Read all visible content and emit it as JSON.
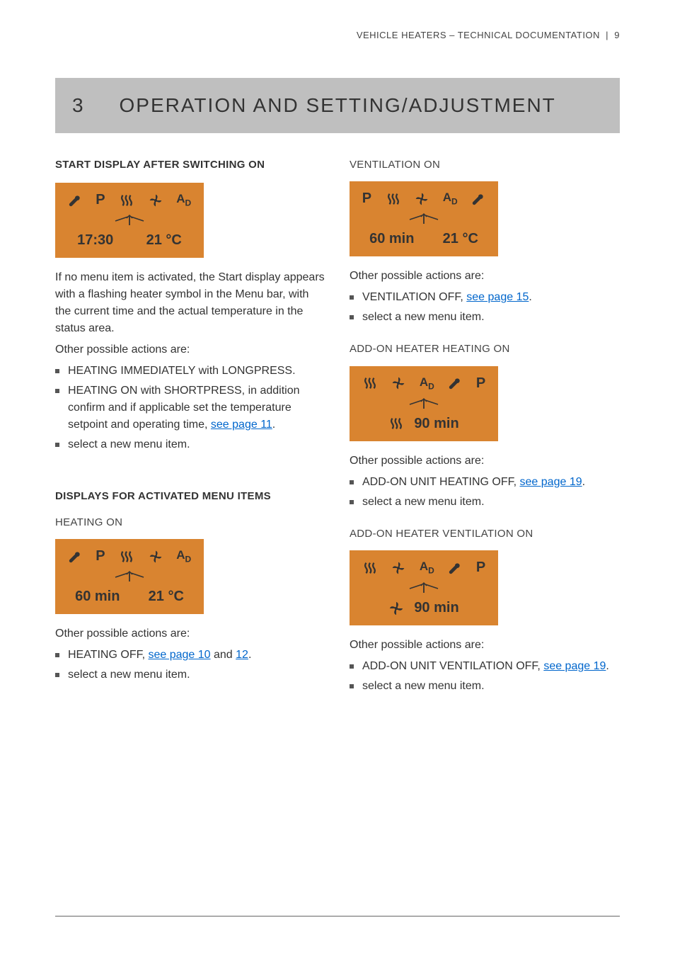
{
  "header": {
    "title": "VEHICLE HEATERS – TECHNICAL DOCUMENTATION",
    "page": "9"
  },
  "chapter": {
    "num": "3",
    "title": "OPERATION AND SETTING/ADJUSTMENT"
  },
  "left": {
    "sec1_title": "START DISPLAY AFTER SWITCHING ON",
    "sec1_display": {
      "time": "17:30",
      "temp": "21 °C",
      "icons": {
        "p": "P",
        "ad": "A",
        "ad_sub": "D"
      }
    },
    "sec1_para": "If no menu item is activated, the Start display appears with a flashing heater symbol in the Menu bar, with the current time and the actual temperature in the status area.",
    "sec1_actions_label": "Other possible actions are:",
    "sec1_li1": "HEATING IMMEDIATELY with LONGPRESS.",
    "sec1_li2a": "HEATING ON with SHORTPRESS, in addition confirm and if applicable set the temperature setpoint and operating time, ",
    "sec1_li2_link": "see page 11",
    "sec1_li2b": ".",
    "sec1_li3": "select a new menu item.",
    "sec2_title": "DISPLAYS FOR ACTIVATED MENU ITEMS",
    "sec2_sub": "HEATING ON",
    "sec2_display": {
      "time": "60 min",
      "temp": "21 °C",
      "icons": {
        "p": "P",
        "ad": "A",
        "ad_sub": "D"
      }
    },
    "sec2_actions_label": "Other possible actions are:",
    "sec2_li1a": "HEATING OFF, ",
    "sec2_li1_link1": "see page 10",
    "sec2_li1_mid": " and ",
    "sec2_li1_link2": "12",
    "sec2_li1b": ".",
    "sec2_li2": "select a new menu item."
  },
  "right": {
    "sec3_sub": "VENTILATION ON",
    "sec3_display": {
      "time": "60 min",
      "temp": "21 °C",
      "icons": {
        "p": "P",
        "ad": "A",
        "ad_sub": "D"
      }
    },
    "sec3_actions_label": "Other possible actions are:",
    "sec3_li1a": "VENTILATION OFF, ",
    "sec3_li1_link": "see page 15",
    "sec3_li1b": ".",
    "sec3_li2": "select a new menu item.",
    "sec4_sub": " ADD-ON HEATER HEATING ON",
    "sec4_display": {
      "time": "90 min",
      "icons": {
        "p": "P",
        "ad": "A",
        "ad_sub": "D"
      }
    },
    "sec4_actions_label": "Other possible actions are:",
    "sec4_li1a": "ADD-ON UNIT HEATING OFF, ",
    "sec4_li1_link": "see page 19",
    "sec4_li1b": ".",
    "sec4_li2": "select a new menu item.",
    "sec5_sub": "ADD-ON HEATER VENTILATION ON",
    "sec5_display": {
      "time": "90 min",
      "icons": {
        "p": "P",
        "ad": "A",
        "ad_sub": "D"
      }
    },
    "sec5_actions_label": "Other possible actions are:",
    "sec5_li1a": "ADD-ON UNIT VENTILATION OFF, ",
    "sec5_li1_link": "see page 19",
    "sec5_li1b": ".",
    "sec5_li2": "select a new menu item."
  }
}
